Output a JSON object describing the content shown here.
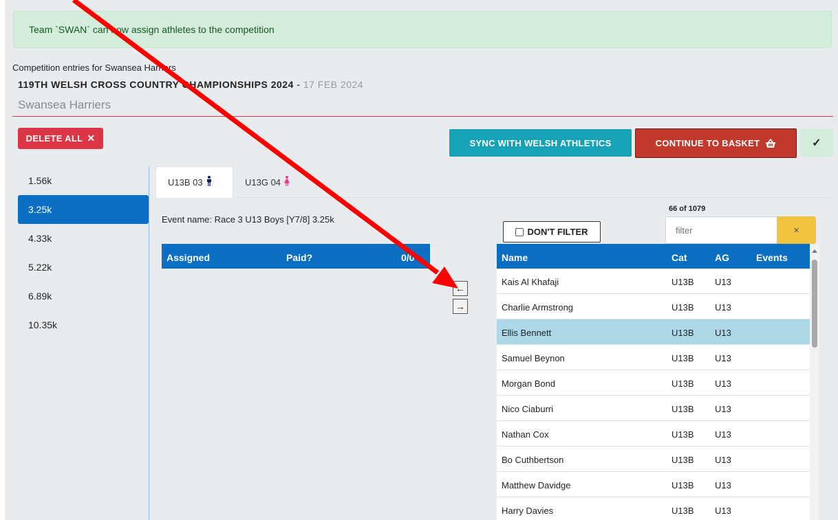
{
  "alert": {
    "text": "Team `SWAN` can now assign athletes to the competition"
  },
  "header": {
    "entries_for": "Competition entries for Swansea Harriers",
    "competition_title": "119TH WELSH CROSS COUNTRY CHAMPIONSHIPS 2024",
    "separator": " - ",
    "competition_date": "17 FEB 2024",
    "club": "Swansea Harriers"
  },
  "toolbar": {
    "delete_all_label": "DELETE ALL",
    "delete_all_icon": "✕",
    "sync_label": "SYNC WITH WELSH ATHLETICS",
    "continue_label": "CONTINUE TO BASKET",
    "check_icon": "✓"
  },
  "sidebar": {
    "items": [
      {
        "label": "1.56k",
        "active": false
      },
      {
        "label": "3.25k",
        "active": true
      },
      {
        "label": "4.33k",
        "active": false
      },
      {
        "label": "5.22k",
        "active": false
      },
      {
        "label": "6.89k",
        "active": false
      },
      {
        "label": "10.35k",
        "active": false
      }
    ]
  },
  "tabs": [
    {
      "label": "U13B 03",
      "icon": "male-icon",
      "glyph": "🚹",
      "active": true
    },
    {
      "label": "U13G 04",
      "icon": "female-icon",
      "glyph": "🚺",
      "active": false
    }
  ],
  "event": {
    "name": "Event name: Race 3 U13 Boys [Y7/8] 3.25k"
  },
  "assigned_table": {
    "col_assigned": "Assigned",
    "col_paid": "Paid?",
    "col_count": "0/0"
  },
  "transfer": {
    "left_arrow": "←",
    "right_arrow": "→"
  },
  "athletes_panel": {
    "count_text": "66 of 1079",
    "dont_filter_label": "DON'T FILTER",
    "filter_placeholder": "filter",
    "filter_clear": "×",
    "columns": {
      "name": "Name",
      "cat": "Cat",
      "ag": "AG",
      "events": "Events"
    },
    "rows": [
      {
        "name": "Kais Al Khafaji",
        "cat": "U13B",
        "ag": "U13",
        "events": ""
      },
      {
        "name": "Charlie Armstrong",
        "cat": "U13B",
        "ag": "U13",
        "events": ""
      },
      {
        "name": "Ellis Bennett",
        "cat": "U13B",
        "ag": "U13",
        "events": ""
      },
      {
        "name": "Samuel Beynon",
        "cat": "U13B",
        "ag": "U13",
        "events": ""
      },
      {
        "name": "Morgan Bond",
        "cat": "U13B",
        "ag": "U13",
        "events": ""
      },
      {
        "name": "Nico Ciaburri",
        "cat": "U13B",
        "ag": "U13",
        "events": ""
      },
      {
        "name": "Nathan Cox",
        "cat": "U13B",
        "ag": "U13",
        "events": ""
      },
      {
        "name": "Bo Cuthbertson",
        "cat": "U13B",
        "ag": "U13",
        "events": ""
      },
      {
        "name": "Matthew Davidge",
        "cat": "U13B",
        "ag": "U13",
        "events": ""
      },
      {
        "name": "Harry Davies",
        "cat": "U13B",
        "ag": "U13",
        "events": ""
      }
    ],
    "highlighted_row": 2
  },
  "colors": {
    "primary_blue": "#0a6fc2",
    "danger_red": "#dc3545",
    "continue_red": "#c0392b",
    "sync_teal": "#17a2b8",
    "success_bg": "#d4edda",
    "highlight_row": "#add8e6",
    "filter_clear_yellow": "#f0c341",
    "annotation_arrow": "#ff0000"
  }
}
